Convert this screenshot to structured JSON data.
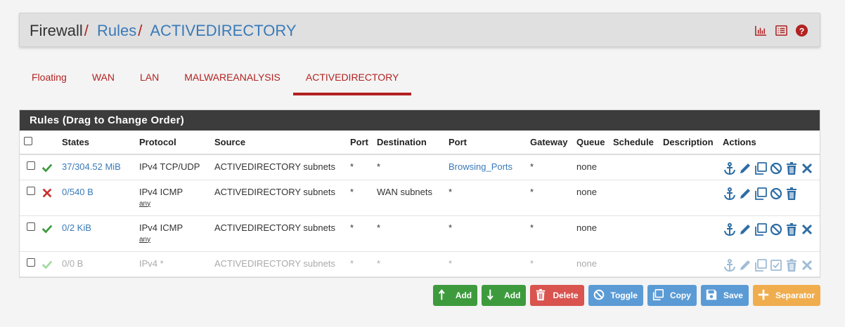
{
  "breadcrumb": {
    "first": "Firewall",
    "second": "Rules",
    "third": "ACTIVEDIRECTORY"
  },
  "header_icons": [
    "chart-icon",
    "list-icon",
    "help-icon"
  ],
  "tabs": [
    {
      "label": "Floating"
    },
    {
      "label": "WAN"
    },
    {
      "label": "LAN"
    },
    {
      "label": "MALWAREANALYSIS"
    },
    {
      "label": "ACTIVEDIRECTORY",
      "active": true
    }
  ],
  "panel": {
    "title": "Rules (Drag to Change Order)",
    "columns": [
      "States",
      "Protocol",
      "Source",
      "Port",
      "Destination",
      "Port",
      "Gateway",
      "Queue",
      "Schedule",
      "Description",
      "Actions"
    ]
  },
  "rules": [
    {
      "status": "pass",
      "states": "37/304.52 MiB",
      "protocol": "IPv4 TCP/UDP",
      "protocol_sub": "",
      "source": "ACTIVEDIRECTORY subnets",
      "src_port": "*",
      "destination": "*",
      "dst_port": "Browsing_Ports",
      "gateway": "*",
      "queue": "none",
      "schedule": "",
      "description": ""
    },
    {
      "status": "block",
      "states": "0/540 B",
      "protocol": "IPv4 ICMP",
      "protocol_sub": "any",
      "source": "ACTIVEDIRECTORY subnets",
      "src_port": "*",
      "destination": "WAN subnets",
      "dst_port": "*",
      "gateway": "*",
      "queue": "none",
      "schedule": "",
      "description": ""
    },
    {
      "status": "pass",
      "states": "0/2 KiB",
      "protocol": "IPv4 ICMP",
      "protocol_sub": "any",
      "source": "ACTIVEDIRECTORY subnets",
      "src_port": "*",
      "destination": "*",
      "dst_port": "*",
      "gateway": "*",
      "queue": "none",
      "schedule": "",
      "description": ""
    },
    {
      "status": "pass-disabled",
      "states": "0/0 B",
      "protocol": "IPv4 *",
      "protocol_sub": "",
      "source": "ACTIVEDIRECTORY subnets",
      "src_port": "*",
      "destination": "*",
      "dst_port": "*",
      "gateway": "*",
      "queue": "none",
      "schedule": "",
      "description": ""
    }
  ],
  "buttons": {
    "add_top": "Add",
    "add_bottom": "Add",
    "delete": "Delete",
    "toggle": "Toggle",
    "copy": "Copy",
    "save": "Save",
    "separator": "Separator"
  },
  "colors": {
    "accent_red": "#b22222",
    "link_blue": "#3a7ab8",
    "pass_green": "#3c9a3c",
    "block_red": "#c9302c",
    "btn_green": "#3d9b3d",
    "btn_red": "#d9534f",
    "btn_blue": "#5b9bd5",
    "btn_orange": "#f0ad4e"
  }
}
